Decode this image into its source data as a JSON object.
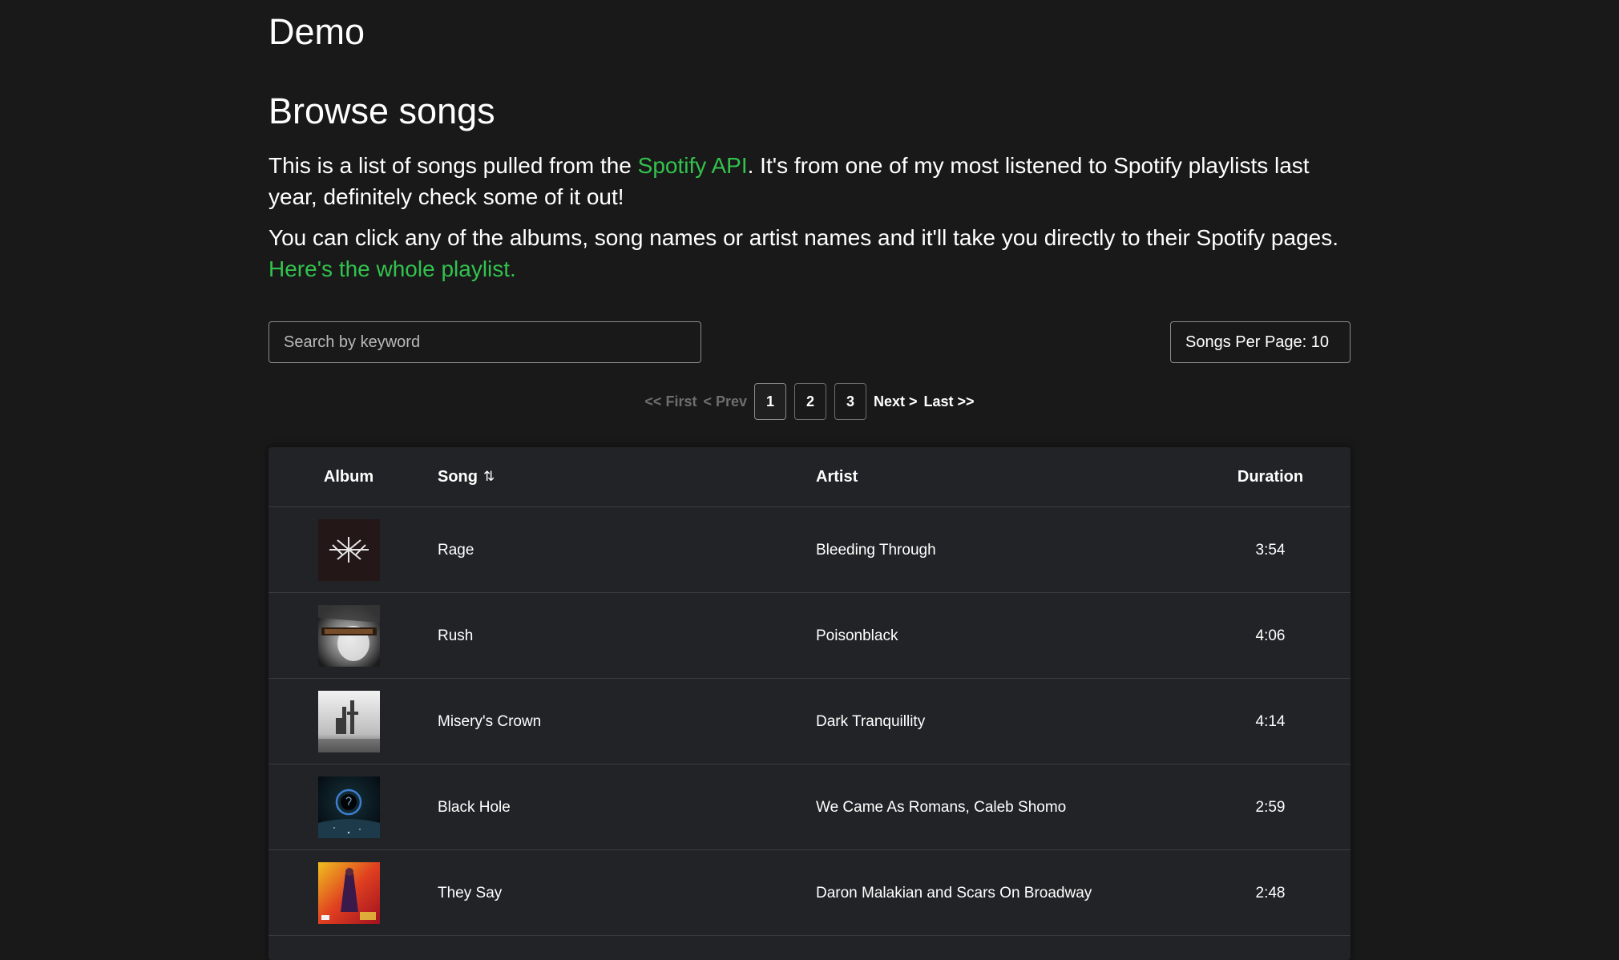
{
  "site_title": "Demo",
  "heading": "Browse songs",
  "intro": {
    "before_link": "This is a list of songs pulled from the ",
    "link_text": "Spotify API",
    "after_link": ". It's from one of my most listened to Spotify playlists last year, definitely check some of it out!"
  },
  "intro2": {
    "text": "You can click any of the albums, song names or artist names and it'll take you directly to their Spotify pages. ",
    "link_text": "Here's the whole playlist."
  },
  "search": {
    "placeholder": "Search by keyword",
    "value": ""
  },
  "per_page": {
    "label": "Songs Per Page: 10"
  },
  "pagination": {
    "first": "<< First",
    "prev": "< Prev",
    "pages": [
      "1",
      "2",
      "3"
    ],
    "current": "1",
    "next": "Next >",
    "last": "Last >>"
  },
  "table": {
    "columns": {
      "album": "Album",
      "song": "Song",
      "artist": "Artist",
      "duration": "Duration"
    },
    "sort_icon": "sort-icon",
    "rows": [
      {
        "song": "Rage",
        "artist": "Bleeding Through",
        "duration": "3:54",
        "album_art": "bleeding-through-cover"
      },
      {
        "song": "Rush",
        "artist": "Poisonblack",
        "duration": "4:06",
        "album_art": "poisonblack-cover"
      },
      {
        "song": "Misery's Crown",
        "artist": "Dark Tranquillity",
        "duration": "4:14",
        "album_art": "dark-tranquillity-cover"
      },
      {
        "song": "Black Hole",
        "artist": "We Came As Romans, Caleb Shomo",
        "duration": "2:59",
        "album_art": "we-came-as-romans-cover"
      },
      {
        "song": "They Say",
        "artist": "Daron Malakian and Scars On Broadway",
        "duration": "2:48",
        "album_art": "scars-on-broadway-cover"
      }
    ]
  },
  "colors": {
    "background": "#191919",
    "accent_link": "#32c24d",
    "table_background": "#222326"
  }
}
